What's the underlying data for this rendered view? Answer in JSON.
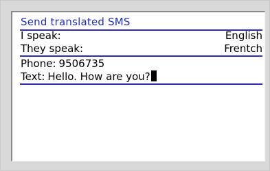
{
  "header": {
    "title": "Send translated SMS"
  },
  "form": {
    "i_speak_label": "I speak:",
    "i_speak_value": "English",
    "they_speak_label": "They speak:",
    "they_speak_value": "Frentch",
    "phone_label": "Phone:",
    "phone_value": "9506735",
    "text_label": "Text:",
    "text_value": "Hello. How are you?"
  },
  "colors": {
    "title": "#1f2fc0",
    "divider": "#2b2bb8",
    "frame": "#d9d9d9"
  }
}
